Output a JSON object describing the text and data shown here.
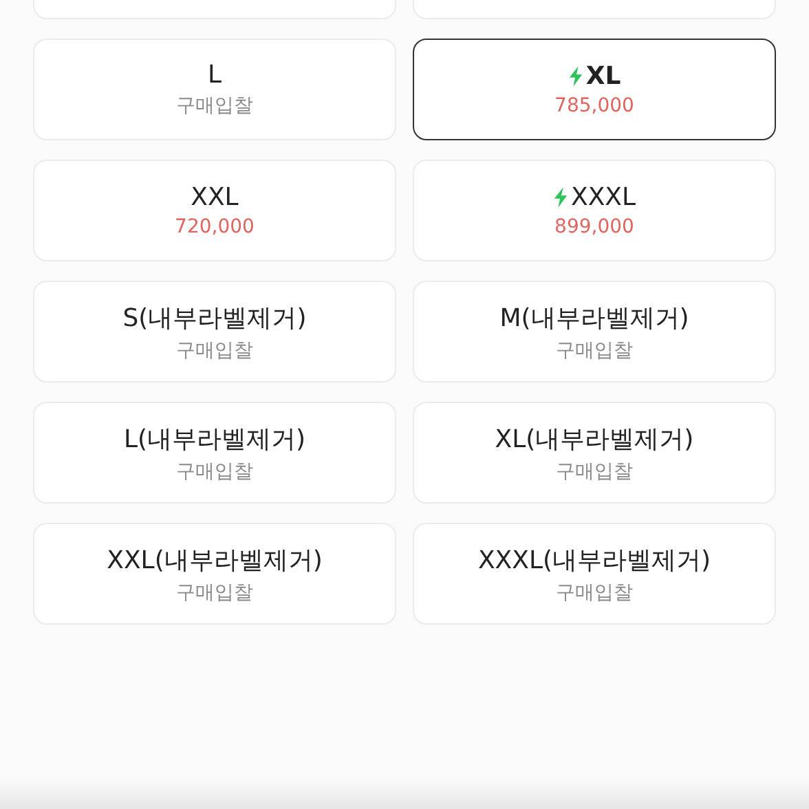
{
  "sizes": [
    {
      "label": "L",
      "sub": "구매입찰",
      "kind": "bid",
      "fast": false,
      "selected": false
    },
    {
      "label": "XL",
      "sub": "785,000",
      "kind": "price",
      "fast": true,
      "selected": true
    },
    {
      "label": "XXL",
      "sub": "720,000",
      "kind": "price",
      "fast": false,
      "selected": false
    },
    {
      "label": "XXXL",
      "sub": "899,000",
      "kind": "price",
      "fast": true,
      "selected": false
    },
    {
      "label": "S(내부라벨제거)",
      "sub": "구매입찰",
      "kind": "bid",
      "fast": false,
      "selected": false
    },
    {
      "label": "M(내부라벨제거)",
      "sub": "구매입찰",
      "kind": "bid",
      "fast": false,
      "selected": false
    },
    {
      "label": "L(내부라벨제거)",
      "sub": "구매입찰",
      "kind": "bid",
      "fast": false,
      "selected": false
    },
    {
      "label": "XL(내부라벨제거)",
      "sub": "구매입찰",
      "kind": "bid",
      "fast": false,
      "selected": false
    },
    {
      "label": "XXL(내부라벨제거)",
      "sub": "구매입찰",
      "kind": "bid",
      "fast": false,
      "selected": false
    },
    {
      "label": "XXXL(내부라벨제거)",
      "sub": "구매입찰",
      "kind": "bid",
      "fast": false,
      "selected": false
    }
  ]
}
